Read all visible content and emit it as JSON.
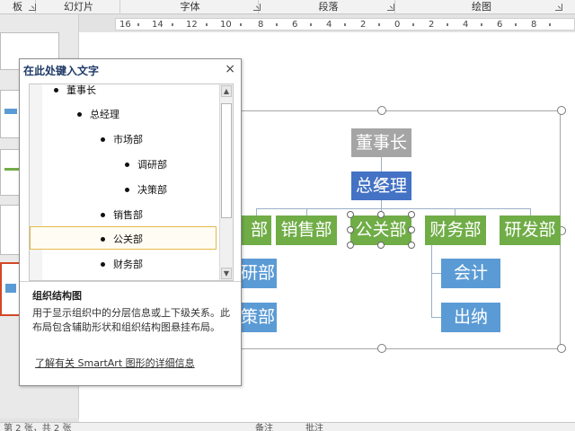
{
  "ribbon": {
    "groups": [
      "板",
      "幻灯片",
      "字体",
      "段落",
      "绘图"
    ]
  },
  "ruler": {
    "numbers": [
      "16",
      "14",
      "12",
      "10",
      "8",
      "6",
      "4",
      "2",
      "0",
      "2",
      "4",
      "6",
      "8"
    ]
  },
  "text_pane": {
    "title": "在此处键入文字",
    "close": "×",
    "items": [
      {
        "text": "董事长",
        "level": 1
      },
      {
        "text": "总经理",
        "level": 2
      },
      {
        "text": "市场部",
        "level": 3
      },
      {
        "text": "调研部",
        "level": 4
      },
      {
        "text": "决策部",
        "level": 4
      },
      {
        "text": "销售部",
        "level": 3
      },
      {
        "text": "公关部",
        "level": 3
      },
      {
        "text": "财务部",
        "level": 3
      }
    ],
    "desc_title": "组织结构图",
    "desc": "用于显示组织中的分层信息或上下级关系。此布局包含辅助形状和组织结构图悬挂布局。",
    "link": "了解有关 SmartArt 图形的详细信息",
    "scroll_up": "▲",
    "scroll_down": "▼"
  },
  "chart": {
    "top": "董事长",
    "manager": "总经理",
    "departments": [
      "部",
      "销售部",
      "公关部",
      "财务部",
      "研发部"
    ],
    "sub_market": [
      "研部",
      "策部"
    ],
    "sub_finance": [
      "会计",
      "出纳"
    ]
  },
  "colors": {
    "gray_node": "#a5a5a5",
    "blue_node": "#4472c4",
    "green_node": "#70ad47",
    "light_blue_node": "#5b9bd5",
    "selection_border": "#e6b84a"
  },
  "status": {
    "left": "第 2 张，共 2 张",
    "notes": "备注",
    "comments": "批注"
  }
}
